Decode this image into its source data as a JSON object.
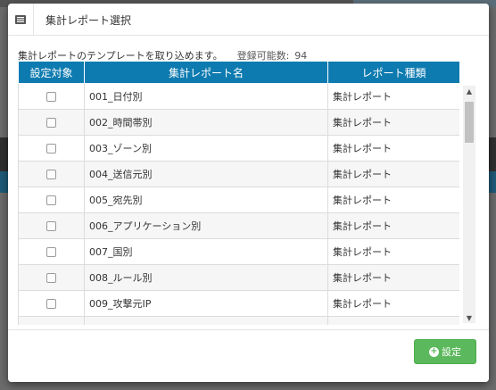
{
  "dialog": {
    "title": "集計レポート選択",
    "description": "集計レポートのテンプレートを取り込めます。",
    "count_label": "登録可能数:",
    "count_value": "94"
  },
  "table": {
    "headers": [
      "設定対象",
      "集計レポート名",
      "レポート種類"
    ],
    "rows": [
      {
        "name": "001_日付別",
        "type": "集計レポート"
      },
      {
        "name": "002_時間帯別",
        "type": "集計レポート"
      },
      {
        "name": "003_ゾーン別",
        "type": "集計レポート"
      },
      {
        "name": "004_送信元別",
        "type": "集計レポート"
      },
      {
        "name": "005_宛先別",
        "type": "集計レポート"
      },
      {
        "name": "006_アプリケーション別",
        "type": "集計レポート"
      },
      {
        "name": "007_国別",
        "type": "集計レポート"
      },
      {
        "name": "008_ルール別",
        "type": "集計レポート"
      },
      {
        "name": "009_攻撃元IP",
        "type": "集計レポート"
      }
    ]
  },
  "footer": {
    "settei_label": "設定"
  },
  "colors": {
    "header_bg": "#0e7bb0",
    "button_bg": "#5cb85c"
  },
  "icons": {
    "dialog": "list-icon",
    "button": "plus-circle-icon"
  }
}
